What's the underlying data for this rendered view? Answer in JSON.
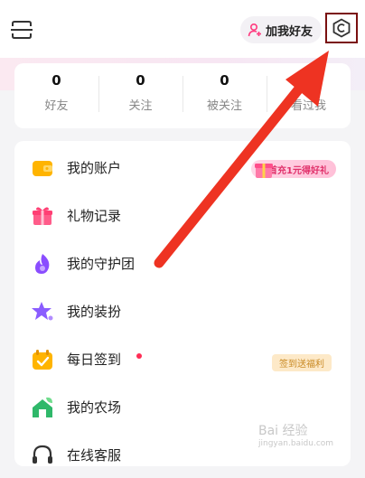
{
  "header": {
    "add_friend_label": "加我好友"
  },
  "stats": [
    {
      "value": "0",
      "label": "好友"
    },
    {
      "value": "0",
      "label": "关注"
    },
    {
      "value": "0",
      "label": "被关注"
    },
    {
      "value": "",
      "label": "看过我"
    }
  ],
  "menu": {
    "items": [
      {
        "label": "我的账户",
        "icon": "wallet-icon"
      },
      {
        "label": "礼物记录",
        "icon": "gift-icon"
      },
      {
        "label": "我的守护团",
        "icon": "guard-flame-icon"
      },
      {
        "label": "我的装扮",
        "icon": "star-icon"
      },
      {
        "label": "每日签到",
        "icon": "calendar-icon"
      },
      {
        "label": "我的农场",
        "icon": "farm-house-icon"
      },
      {
        "label": "在线客服",
        "icon": "headset-icon"
      }
    ],
    "account_badge": "首充1元得好礼",
    "signin_badge": "签到送福利"
  },
  "annotation": {
    "arrow_color": "#ee3322",
    "highlight_color": "#7a1010"
  },
  "watermark": {
    "text": "Bai 经验",
    "sub": "jingyan.baidu.com"
  },
  "colors": {
    "accent_pink": "#ff2d77",
    "badge_gold": "#c98a24"
  }
}
